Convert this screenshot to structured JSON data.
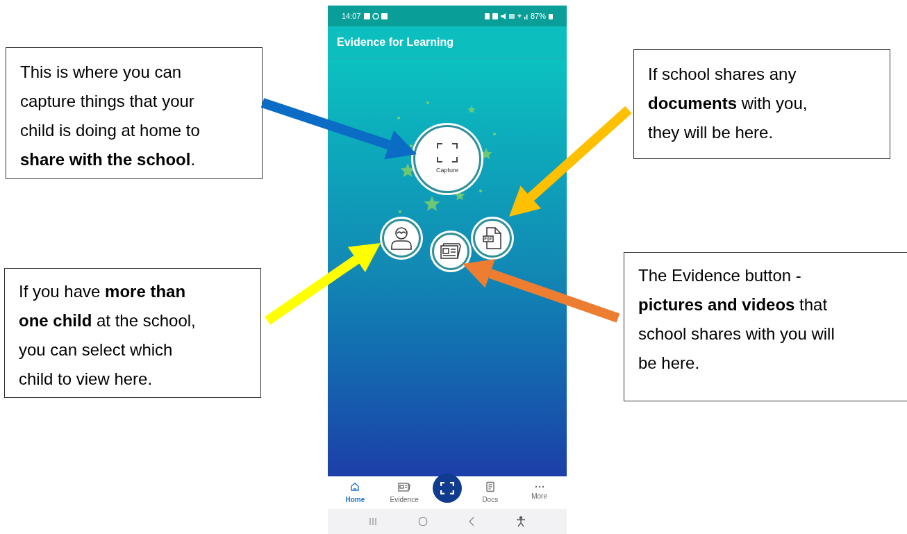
{
  "status_bar": {
    "time": "14:07",
    "battery": "87%"
  },
  "app_bar": {
    "title": "Evidence for Learning"
  },
  "home": {
    "capture_label": "Capture"
  },
  "nav": [
    {
      "label": "Home",
      "selected": true
    },
    {
      "label": "Evidence",
      "selected": false
    },
    {
      "label": "Docs",
      "selected": false
    },
    {
      "label": "More",
      "selected": false
    }
  ],
  "callouts": [
    {
      "text": "This is where you can\ncapture things that your\nchild is doing at home to\n**share with the school**."
    },
    {
      "text": "If school shares any\n**documents** with you,\nthey will be here."
    },
    {
      "text": "The Evidence button -\n**pictures and videos** that\nschool shares with you will\nbe here."
    },
    {
      "text": "If you have **more than**\n**one child** at the school,\nyou can select which\nchild to view here."
    }
  ]
}
